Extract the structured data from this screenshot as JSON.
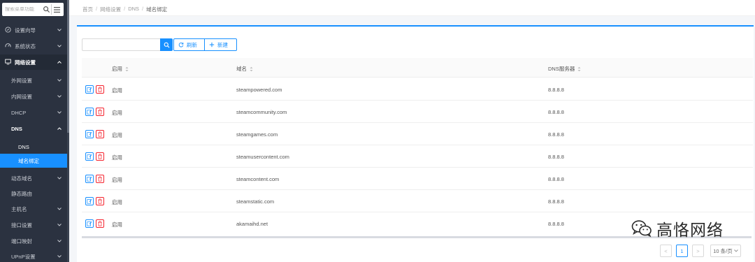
{
  "sidebar": {
    "search_placeholder": "搜索菜单功能",
    "items": [
      {
        "label": "设置向导"
      },
      {
        "label": "系统状态"
      },
      {
        "label": "网络设置"
      },
      {
        "label": "外网设置"
      },
      {
        "label": "内网设置"
      },
      {
        "label": "DHCP"
      },
      {
        "label": "DNS"
      },
      {
        "label": "DNS"
      },
      {
        "label": "域名绑定"
      },
      {
        "label": "动态域名"
      },
      {
        "label": "静态路由"
      },
      {
        "label": "主机名"
      },
      {
        "label": "接口设置"
      },
      {
        "label": "端口映射"
      },
      {
        "label": "UPnP设置"
      }
    ]
  },
  "breadcrumb": {
    "home": "首页",
    "level1": "网络设置",
    "level2": "DNS",
    "current": "域名绑定",
    "sep": "/"
  },
  "toolbar": {
    "search_value": "",
    "refresh_label": "刷新",
    "new_label": "新建"
  },
  "table": {
    "columns": [
      "启用",
      "域名",
      "DNS服务器"
    ],
    "rows": [
      {
        "enabled": "启用",
        "domain": "steampowered.com",
        "dns": "8.8.8.8"
      },
      {
        "enabled": "启用",
        "domain": "steamcommunity.com",
        "dns": "8.8.8.8"
      },
      {
        "enabled": "启用",
        "domain": "steamgames.com",
        "dns": "8.8.8.8"
      },
      {
        "enabled": "启用",
        "domain": "steamusercontent.com",
        "dns": "8.8.8.8"
      },
      {
        "enabled": "启用",
        "domain": "steamcontent.com",
        "dns": "8.8.8.8"
      },
      {
        "enabled": "启用",
        "domain": "steamstatic.com",
        "dns": "8.8.8.8"
      },
      {
        "enabled": "启用",
        "domain": "akamaihd.net",
        "dns": "8.8.8.8"
      }
    ]
  },
  "pagination": {
    "prev": "<",
    "page": "1",
    "next": ">",
    "page_size": "10 条/页"
  },
  "watermark": {
    "text": "高恪网络"
  },
  "colors": {
    "accent": "#1890ff",
    "danger": "#f5222d",
    "sidebar_bg": "#2b3240"
  }
}
